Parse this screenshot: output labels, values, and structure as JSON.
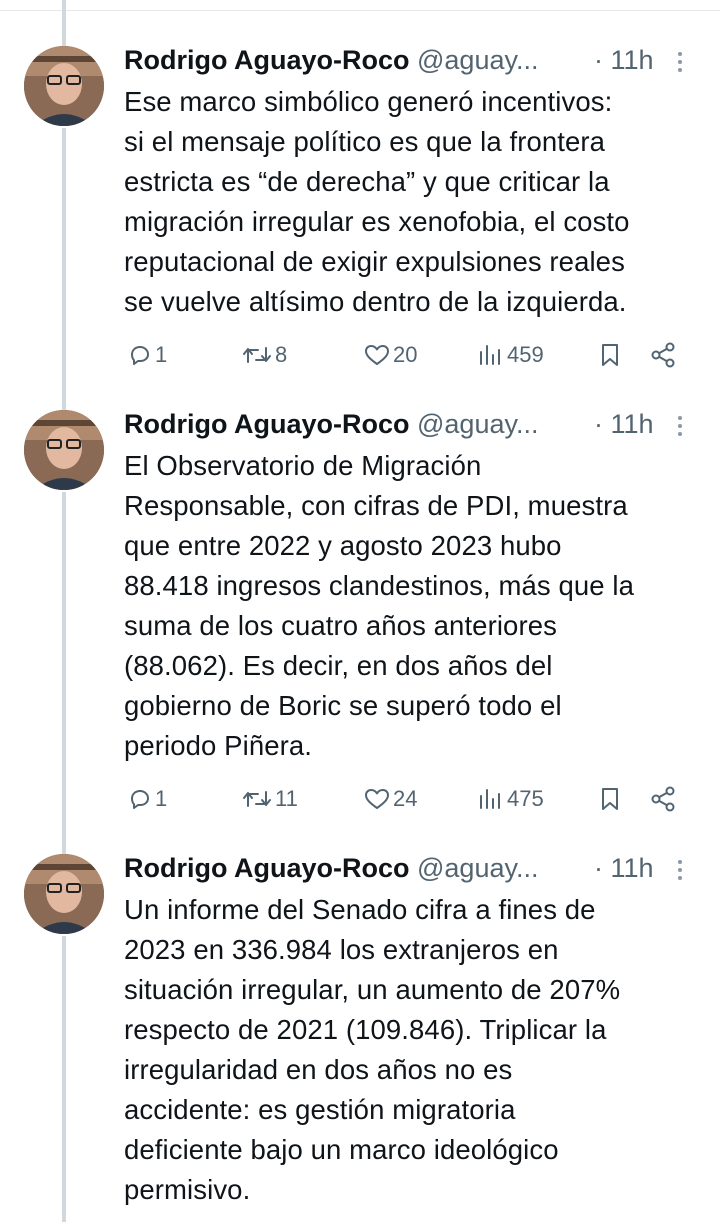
{
  "tweets": [
    {
      "name": "Rodrigo Aguayo-Roco",
      "handle": "@aguay...",
      "time": "· 11h",
      "lines": [
        "Ese marco simbólico generó incentivos:",
        "si el mensaje político es que la frontera",
        "estricta es “de derecha” y que criticar la",
        "migración irregular es xenofobia, el costo",
        "reputacional de exigir expulsiones reales",
        "se vuelve altísimo dentro de la izquierda."
      ],
      "replies": "1",
      "reposts": "8",
      "likes": "20",
      "views": "459"
    },
    {
      "name": "Rodrigo Aguayo-Roco",
      "handle": "@aguay...",
      "time": "· 11h",
      "lines": [
        "El Observatorio de Migración",
        "Responsable, con cifras de PDI, muestra",
        "que entre 2022 y agosto 2023 hubo",
        "88.418 ingresos clandestinos, más que la",
        "suma de los cuatro años anteriores",
        "(88.062). Es decir, en dos años del",
        "gobierno de Boric se superó todo el",
        "periodo Piñera."
      ],
      "replies": "1",
      "reposts": "11",
      "likes": "24",
      "views": "475"
    },
    {
      "name": "Rodrigo Aguayo-Roco",
      "handle": "@aguay...",
      "time": "· 11h",
      "lines": [
        "Un informe del Senado cifra a fines de",
        "2023 en 336.984 los extranjeros en",
        "situación irregular, un aumento de 207%",
        "respecto de 2021 (109.846). Triplicar la",
        "irregularidad en dos años no es",
        "accidente: es gestión migratoria",
        "deficiente bajo un marco ideológico",
        "permisivo."
      ]
    }
  ],
  "colors": {
    "text": "#0f1419",
    "secondary": "#536471",
    "thread_line": "#cfd9de"
  },
  "icons": [
    "reply-icon",
    "repost-icon",
    "like-icon",
    "views-icon",
    "bookmark-icon",
    "share-icon",
    "more-icon"
  ]
}
